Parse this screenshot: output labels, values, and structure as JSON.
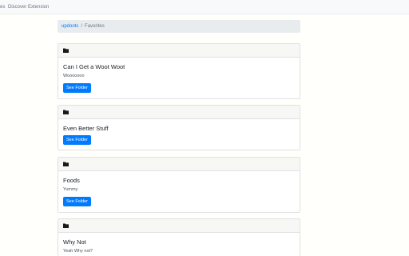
{
  "nav": {
    "items": [
      "es",
      "Discover",
      "Extension"
    ]
  },
  "breadcrumb": {
    "home": "updoots",
    "separator": "/",
    "current": "Favorites"
  },
  "folders": [
    {
      "title": "Can I Get a Woot Woot",
      "description": "Wooooooo",
      "button": "See Folder"
    },
    {
      "title": "Even Better Stuff",
      "description": "",
      "button": "See Folder"
    },
    {
      "title": "Foods",
      "description": "Yummy",
      "button": "See Folder"
    },
    {
      "title": "Why Not",
      "description": "Yeah Why not?",
      "button": ""
    }
  ],
  "colors": {
    "primary": "#007bff",
    "header_bg": "#f7f7f5",
    "page_bg": "#fffffb"
  },
  "icons": {
    "folder": "folder-icon"
  }
}
